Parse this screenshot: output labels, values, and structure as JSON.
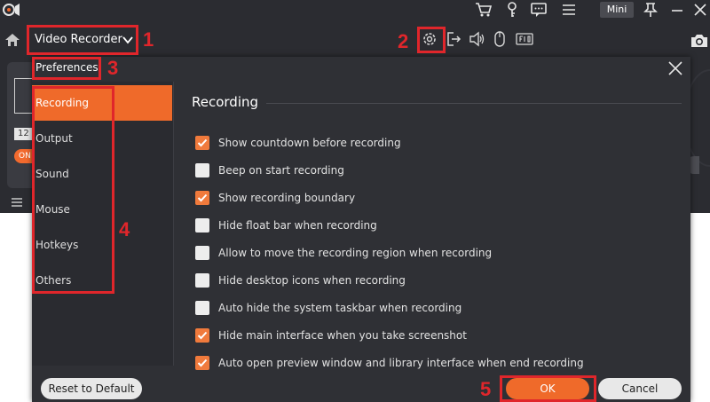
{
  "app": {
    "mini_label": "Mini",
    "mode_label": "Video Recorder",
    "side_number": "12",
    "side_toggle": "ON"
  },
  "dialog": {
    "title": "Preferences",
    "section_title": "Recording",
    "nav": [
      {
        "label": "Recording",
        "active": true
      },
      {
        "label": "Output",
        "active": false
      },
      {
        "label": "Sound",
        "active": false
      },
      {
        "label": "Mouse",
        "active": false
      },
      {
        "label": "Hotkeys",
        "active": false
      },
      {
        "label": "Others",
        "active": false
      }
    ],
    "options": [
      {
        "label": "Show countdown before recording",
        "checked": true
      },
      {
        "label": "Beep on start recording",
        "checked": false
      },
      {
        "label": "Show recording boundary",
        "checked": true
      },
      {
        "label": "Hide float bar when recording",
        "checked": false
      },
      {
        "label": "Allow to move the recording region when recording",
        "checked": false
      },
      {
        "label": "Hide desktop icons when recording",
        "checked": false
      },
      {
        "label": "Auto hide the system taskbar when recording",
        "checked": false
      },
      {
        "label": "Hide main interface when you take screenshot",
        "checked": true
      },
      {
        "label": "Auto open preview window and library interface when end recording",
        "checked": true
      }
    ],
    "buttons": {
      "reset": "Reset to Default",
      "ok": "OK",
      "cancel": "Cancel"
    }
  },
  "annotations": {
    "n1": "1",
    "n2": "2",
    "n3": "3",
    "n4": "4",
    "n5": "5"
  },
  "colors": {
    "accent": "#ef6a2a",
    "annotation": "#e0262b",
    "panel": "#2f3035"
  }
}
